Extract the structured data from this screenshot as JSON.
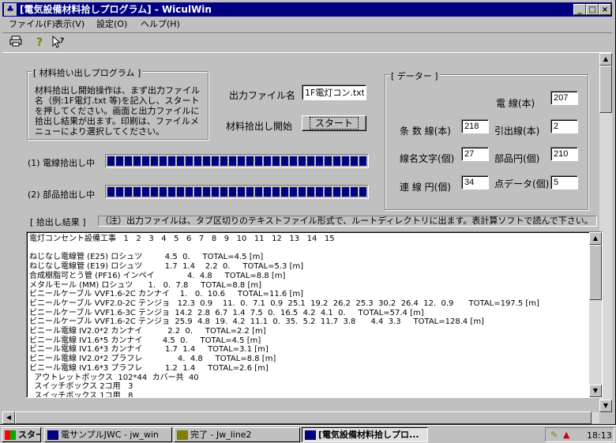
{
  "window": {
    "title": "[電気設備材料拾しプログラム] - WiculWin",
    "controls": {
      "minimize": "_",
      "maximize": "□",
      "close": "×"
    }
  },
  "menubar": [
    "ファイル(F)",
    "表示(V)",
    "設定(O)",
    "ヘルプ(H)"
  ],
  "toolbar": {
    "icons": [
      "printer-icon",
      "help-icon",
      "context-help-icon"
    ]
  },
  "program_group": {
    "label": "[ 材料拾い出しプログラム ]",
    "description": "材料拾出し開始操作は、まず出力ファイル名（例:1F電灯.txt 等)を記入し、スタートを押してください。画面と出力ファイルに拾出し結果が出ます。印刷は、ファイルメニューにより選択してください。"
  },
  "output": {
    "filename_label": "出力ファイル名",
    "filename_value": "1F電灯コン.txt",
    "start_label": "材料拾出し開始",
    "start_button": "スタート"
  },
  "progress": [
    {
      "label": "(1) 電線拾出し中",
      "fraction": 1.0
    },
    {
      "label": "(2) 部品拾出し中",
      "fraction": 1.0
    }
  ],
  "data_group": {
    "label": "[ データー ]",
    "fields": [
      {
        "label": "電 線(本)",
        "value": "207"
      },
      {
        "label": "条 数 線(本)",
        "value": "218"
      },
      {
        "label": "引出線(本)",
        "value": "2"
      },
      {
        "label": "線名文字(個)",
        "value": "27"
      },
      {
        "label": "部品円(個)",
        "value": "210"
      },
      {
        "label": "連 線 円(個)",
        "value": "34"
      },
      {
        "label": "点データ(個)",
        "value": "5"
      }
    ]
  },
  "result": {
    "label": "[ 拾出し結果 ]",
    "note": "（注）出力ファイルは、タブ区切りのテキストファイル形式で、ルートディレクトリに出ます。表計算ソフトで読んで下さい。",
    "lines": [
      "電灯コンセント設備工事   1   2   3   4   5   6   7   8   9   10   11   12   13   14   15",
      "",
      "ねじなし電線管 (E25) ロシュツ         4.5  0.     TOTAL=4.5 [m]",
      "ねじなし電線管 (E19) ロシュツ         1.7  1.4    2.2  0.     TOTAL=5.3 [m]",
      "合成樹脂可とう管 (PF16) インペイ             4.  4.8     TOTAL=8.8 [m]",
      "メタルモール (MM) ロシュツ      1.   0.  7.8     TOTAL=8.8 [m]",
      "ビニールケーブル VVF1.6-2C カンナイ    1.   0.  10.6     TOTAL=11.6 [m]",
      "ビニールケーブル VVF2.0-2C テンジョ   12.3  0.9    11.  0.  7.1  0.9  25.1  19.2  26.2  25.3  30.2  26.4  12.  0.9      TOTAL=197.5 [m]",
      "ビニールケーブル VVF1.6-3C テンジョ  14.2  2.8  6.7  1.4  7.5  0.  16.5  4.2  4.1  0.     TOTAL=57.4 [m]",
      "ビニールケーブル VVF1.6-2C テンジョ  25.9  4.8  19.  4.2  11.1  0.  35.  5.2  11.7  3.8      4.4  3.3     TOTAL=128.4 [m]",
      "ビニール電線 IV2.0*2 カンナイ          2.2  0.     TOTAL=2.2 [m]",
      "ビニール電線 IV1.6*5 カンナイ        4.5  0.     TOTAL=4.5 [m]",
      "ビニール電線 IV1.6*3 カンナイ         1.7  1.4     TOTAL=3.1 [m]",
      "ビニール電線 IV2.0*2 プラフレ              4.  4.8     TOTAL=8.8 [m]",
      "ビニール電線 IV1.6*3 プラフレ         1.2  1.4     TOTAL=2.6 [m]",
      "  アウトレットボックス  102*44  カバー共  40",
      "  スイッチボックス 2コ用   3",
      "  スイッチボックス 1コ用   8"
    ]
  },
  "taskbar": {
    "start": "スタート",
    "items": [
      {
        "label": "電サンプルJWC - jw_win",
        "active": false
      },
      {
        "label": "完了 - Jw_line2",
        "active": false
      },
      {
        "label": "[電気設備材料拾しプロ...",
        "active": true
      }
    ],
    "clock": "18:13"
  }
}
